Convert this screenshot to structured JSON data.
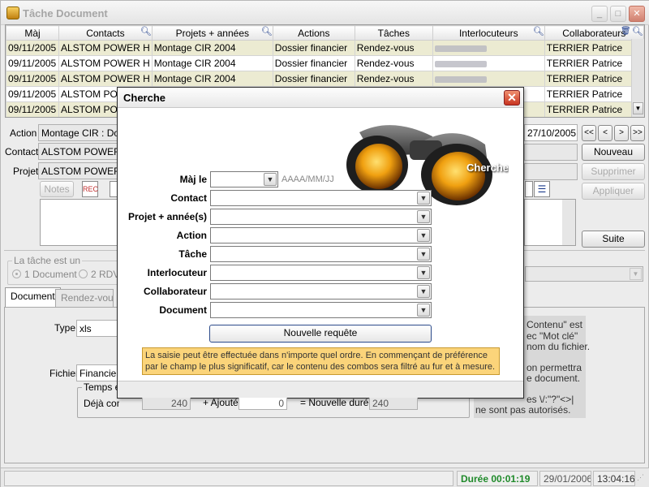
{
  "window": {
    "title": "Tâche Document",
    "controls": {
      "minimize": "_",
      "maximize": "□",
      "close": "✕"
    }
  },
  "grid": {
    "columns": [
      "Màj",
      "Contacts",
      "Projets + années",
      "Actions",
      "Tâches",
      "Interlocuteurs",
      "Collaborateurs"
    ],
    "rows": [
      [
        "09/11/2005",
        "ALSTOM POWER H",
        "Montage CIR 2004",
        "Dossier financier",
        "Rendez-vous",
        "",
        "TERRIER Patrice"
      ],
      [
        "09/11/2005",
        "ALSTOM POWER H",
        "Montage CIR 2004",
        "Dossier financier",
        "Rendez-vous",
        "",
        "TERRIER Patrice"
      ],
      [
        "09/11/2005",
        "ALSTOM POWER H",
        "Montage CIR 2004",
        "Dossier financier",
        "Rendez-vous",
        "",
        "TERRIER Patrice"
      ],
      [
        "09/11/2005",
        "ALSTOM POW",
        "",
        "",
        "",
        "",
        "TERRIER Patrice"
      ],
      [
        "09/11/2005",
        "ALSTOM POW",
        "",
        "",
        "",
        "",
        "TERRIER Patrice"
      ]
    ]
  },
  "form": {
    "action_label": "Action",
    "action_value": "Montage CIR : Doss",
    "contact_label": "Contact",
    "contact_value": "ALSTOM POWER H",
    "projet_label": "Projet",
    "projet_value": "ALSTOM POWER H",
    "date_value": "27/10/2005",
    "notes_button": "Notes",
    "buttons": {
      "nouveau": "Nouveau",
      "supprimer": "Supprimer",
      "appliquer": "Appliquer",
      "suite": "Suite"
    },
    "nav": [
      "<<",
      "<",
      ">",
      ">>"
    ]
  },
  "task_group": {
    "legend": "La tâche est un",
    "options": [
      "1 Document",
      "2 RDV"
    ]
  },
  "tabs": [
    "Document",
    "Rendez-vous"
  ],
  "document": {
    "type_label": "Type",
    "type_value": "xls",
    "fichier_label": "Fichier",
    "fichier_value": "Financier",
    "temps_legend": "Temps ef",
    "deja_label": "Déjà consacré",
    "deja_value": "240",
    "ajoute_label": "+ Ajouté",
    "ajoute_value": "0",
    "nouvelle_label": "= Nouvelle durée",
    "nouvelle_value": "240",
    "help_lines": [
      "Contenu\" est",
      "ec \"Mot clé\"",
      "nom du fichier.",
      "on permettra",
      "e document.",
      "es \\/:\"?\"<>|",
      "ne sont pas autorisés."
    ]
  },
  "status": {
    "duree": "Durée 00:01:19",
    "date": "29/01/2006",
    "time": "13:04:16"
  },
  "dialog": {
    "title": "Cherche",
    "close": "✕",
    "image_label": "Cherche",
    "maj_label": "Màj le",
    "date_format": "AAAA/MM/JJ",
    "fields": [
      "Contact",
      "Projet + année(s)",
      "Action",
      "Tâche",
      "Interlocuteur",
      "Collaborateur",
      "Document"
    ],
    "button": "Nouvelle requête",
    "hint": "La saisie peut être effectuée dans n'importe quel ordre. En commençant de préférence par le champ le plus significatif, car le contenu des combos sera filtré au fur et à mesure."
  },
  "colors": {
    "grid_alt_row": "#ecebd2",
    "hint_bg": "#fbd47a",
    "status_green": "#1f8a2a",
    "dialog_close": "#c83420"
  }
}
